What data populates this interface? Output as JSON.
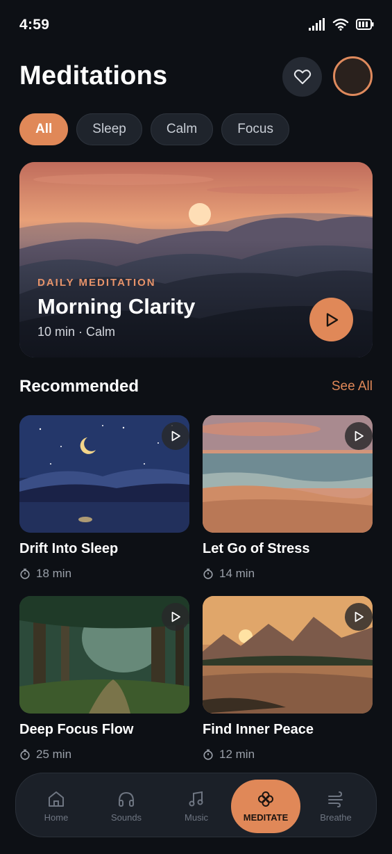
{
  "status": {
    "time": "4:59"
  },
  "header": {
    "title": "Meditations",
    "favorite_icon": "heart-icon"
  },
  "filters": [
    {
      "label": "All",
      "active": true
    },
    {
      "label": "Sleep",
      "active": false
    },
    {
      "label": "Calm",
      "active": false
    },
    {
      "label": "Focus",
      "active": false
    }
  ],
  "featured": {
    "eyebrow": "DAILY MEDITATION",
    "title": "Morning Clarity",
    "meta": "10 min · Calm"
  },
  "recommended": {
    "title": "Recommended",
    "see_all": "See All",
    "items": [
      {
        "title": "Drift Into Sleep",
        "duration": "18 min"
      },
      {
        "title": "Let Go of Stress",
        "duration": "14 min"
      },
      {
        "title": "Deep Focus Flow",
        "duration": "25 min"
      },
      {
        "title": "Find Inner Peace",
        "duration": "12 min"
      }
    ]
  },
  "nav": [
    {
      "label": "Home",
      "icon": "home-icon"
    },
    {
      "label": "Sounds",
      "icon": "headphones-icon"
    },
    {
      "label": "Music",
      "icon": "music-note-icon"
    },
    {
      "label": "MEDITATE",
      "icon": "flower-icon",
      "active": true
    },
    {
      "label": "Breathe",
      "icon": "wind-icon"
    }
  ],
  "colors": {
    "accent": "#e08858",
    "background": "#0d1015",
    "surface": "#1f242c"
  }
}
